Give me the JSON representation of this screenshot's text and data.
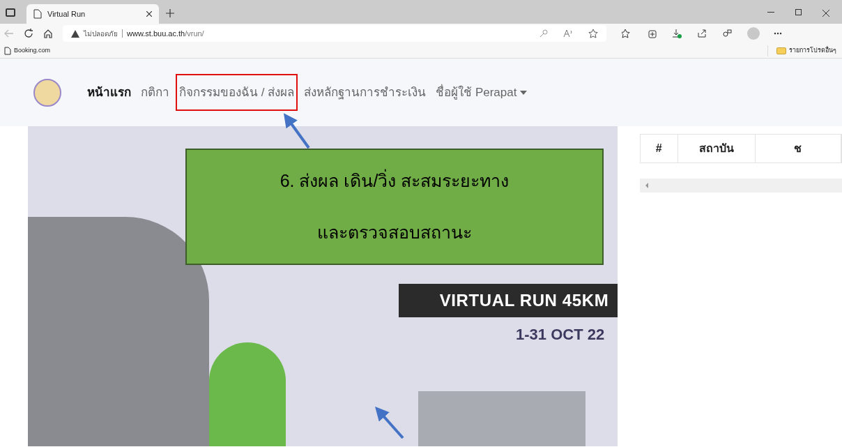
{
  "browser": {
    "tab_title": "Virtual Run",
    "security_label": "ไม่ปลอดภัย",
    "url_host": "www.st.buu.ac.th",
    "url_path": "/vrun/",
    "bookmarks": [
      "Booking.com"
    ],
    "other_favorites": "รายการโปรดอื่นๆ"
  },
  "navbar": {
    "items": [
      {
        "label": "หน้าแรก",
        "selected": true,
        "kind": "link"
      },
      {
        "label": "กติกา",
        "selected": false,
        "kind": "link"
      },
      {
        "label": "กิจกรรมของฉัน / ส่งผล",
        "selected": false,
        "kind": "link",
        "highlighted": true
      },
      {
        "label": "ส่งหลักฐานการชำระเงิน",
        "selected": false,
        "kind": "link"
      },
      {
        "label": "ชื่อผู้ใช้ Perapat",
        "selected": false,
        "kind": "dropdown"
      }
    ]
  },
  "poster": {
    "banner": "VIRTUAL RUN 45KM",
    "dates": "1-31 OCT 22"
  },
  "table": {
    "columns": [
      "#",
      "สถาบัน",
      "ช"
    ]
  },
  "annotation": {
    "lines": [
      "6. ส่งผล เดิน/วิ่ง สะสมระยะทาง",
      "และตรวจสอบสถานะ"
    ]
  }
}
